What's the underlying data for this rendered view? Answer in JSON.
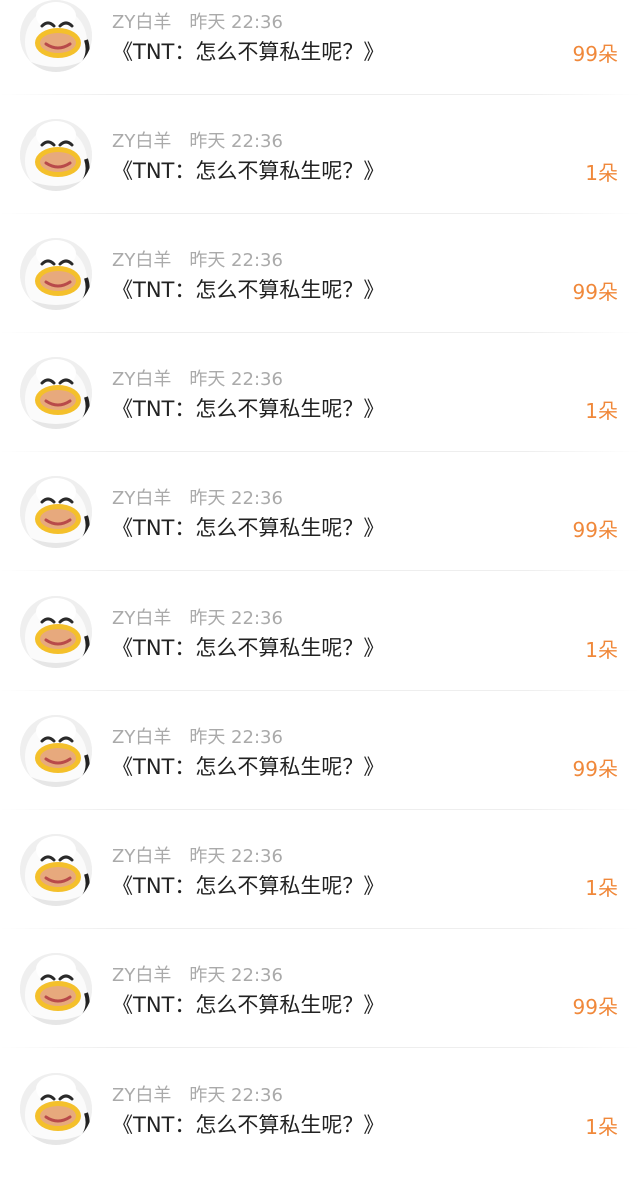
{
  "colors": {
    "accent": "#f0883a",
    "meta_text": "#aaaaaa",
    "main_text": "#222222"
  },
  "comments": [
    {
      "user": "ZY白羊",
      "time": "昨天 22:36",
      "text": "《TNT：怎么不算私生呢？》",
      "count": "99朵",
      "avatar_icon": "duck-costume-avatar"
    },
    {
      "user": "ZY白羊",
      "time": "昨天 22:36",
      "text": "《TNT：怎么不算私生呢？》",
      "count": "1朵",
      "avatar_icon": "duck-costume-avatar"
    },
    {
      "user": "ZY白羊",
      "time": "昨天 22:36",
      "text": "《TNT：怎么不算私生呢？》",
      "count": "99朵",
      "avatar_icon": "duck-costume-avatar"
    },
    {
      "user": "ZY白羊",
      "time": "昨天 22:36",
      "text": "《TNT：怎么不算私生呢？》",
      "count": "1朵",
      "avatar_icon": "duck-costume-avatar"
    },
    {
      "user": "ZY白羊",
      "time": "昨天 22:36",
      "text": "《TNT：怎么不算私生呢？》",
      "count": "99朵",
      "avatar_icon": "duck-costume-avatar"
    },
    {
      "user": "ZY白羊",
      "time": "昨天 22:36",
      "text": "《TNT：怎么不算私生呢？》",
      "count": "1朵",
      "avatar_icon": "duck-costume-avatar"
    },
    {
      "user": "ZY白羊",
      "time": "昨天 22:36",
      "text": "《TNT：怎么不算私生呢？》",
      "count": "99朵",
      "avatar_icon": "duck-costume-avatar"
    },
    {
      "user": "ZY白羊",
      "time": "昨天 22:36",
      "text": "《TNT：怎么不算私生呢？》",
      "count": "1朵",
      "avatar_icon": "duck-costume-avatar"
    },
    {
      "user": "ZY白羊",
      "time": "昨天 22:36",
      "text": "《TNT：怎么不算私生呢？》",
      "count": "99朵",
      "avatar_icon": "duck-costume-avatar"
    },
    {
      "user": "ZY白羊",
      "time": "昨天 22:36",
      "text": "《TNT：怎么不算私生呢？》",
      "count": "1朵",
      "avatar_icon": "duck-costume-avatar"
    }
  ]
}
